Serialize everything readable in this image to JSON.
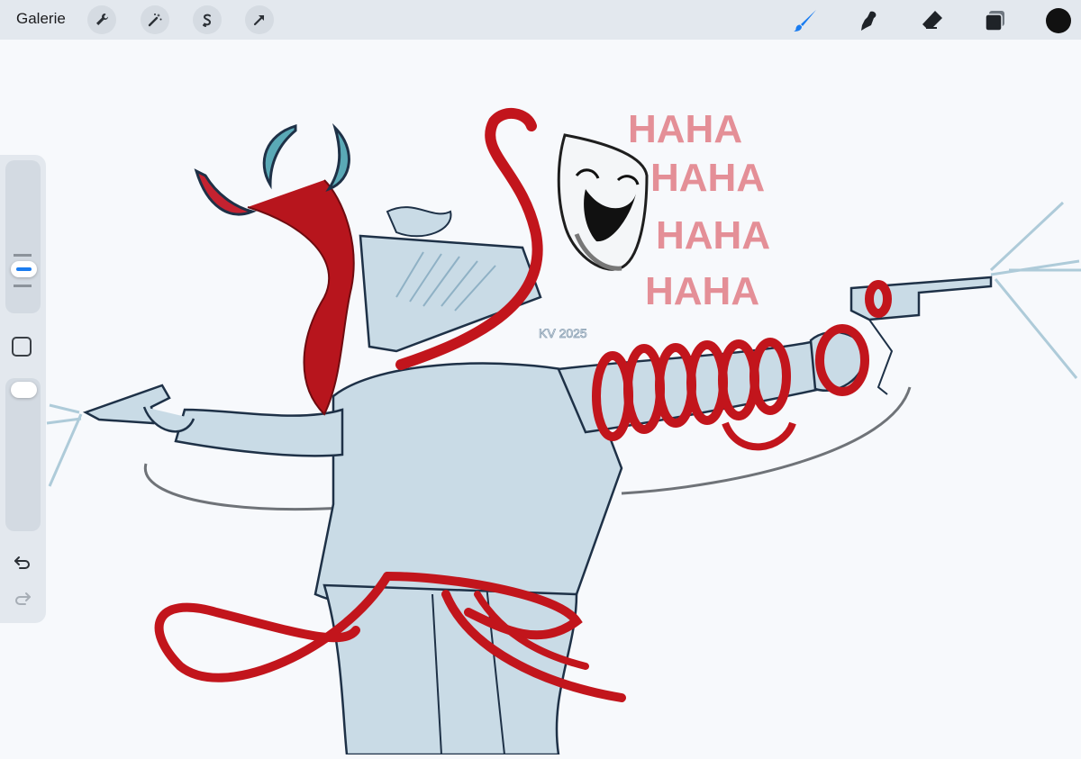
{
  "topbar": {
    "gallery_label": "Galerie",
    "left_tools": [
      "wrench-icon",
      "magic-wand-icon",
      "selection-icon",
      "transform-arrow-icon"
    ],
    "right_tools": [
      "brush-icon",
      "smudge-icon",
      "eraser-icon",
      "layers-icon",
      "color-swatch"
    ],
    "active_tool": "brush",
    "accent_color": "#1a7cf0",
    "current_color": "#111111"
  },
  "sidebar": {
    "brush_size": 0.33,
    "brush_opacity": 1.0,
    "undo": "undo-arrow-icon",
    "redo": "redo-arrow-icon"
  },
  "artwork": {
    "laugh_lines": [
      "HAHA",
      "HAHA",
      "HAHA",
      "HAHA"
    ],
    "signature": "KV 2025",
    "ink_color": "#1e3147",
    "fill_color": "#c9dbe6",
    "ribbon_color": "#c2151c"
  }
}
